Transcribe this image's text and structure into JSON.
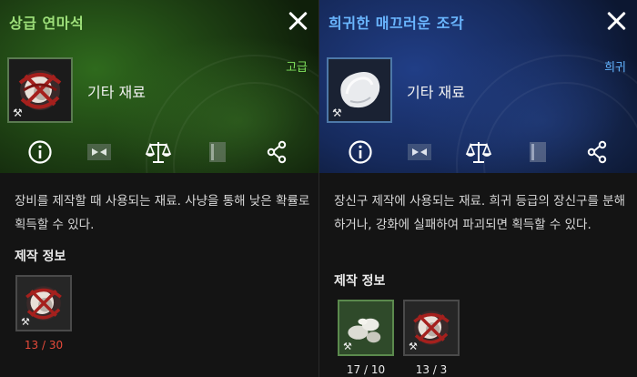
{
  "left_panel": {
    "title": "상급 연마석",
    "grade": "고급",
    "item_type": "기타 재료",
    "description": "장비를 제작할 때 사용되는 재료. 사냥을 통해 낮은 확률로 획득할 수 있다.",
    "craft_section_title": "제작 정보",
    "craft_items": [
      {
        "count": "13 / 30",
        "icon": "whetstone-icon"
      }
    ]
  },
  "right_panel": {
    "title": "희귀한 매끄러운 조각",
    "grade": "희귀",
    "item_type": "기타 재료",
    "description": "장신구 제작에 사용되는 재료. 희귀 등급의 장신구를 분해하거나, 강화에 실패하여 파괴되면 획득할 수 있다.",
    "craft_section_title": "제작 정보",
    "craft_items": [
      {
        "count": "17 / 10",
        "icon": "smooth-shards-icon"
      },
      {
        "count": "13 / 3",
        "icon": "whetstone-icon"
      }
    ]
  },
  "toolbar_icons": [
    "info-icon",
    "transfer-icon",
    "scale-icon",
    "book-icon",
    "share-icon"
  ],
  "colors": {
    "left_title": "#9ee07a",
    "right_title": "#6ab6ff",
    "insufficient_count": "#e84a3a",
    "sufficient_count": "#ececec"
  }
}
